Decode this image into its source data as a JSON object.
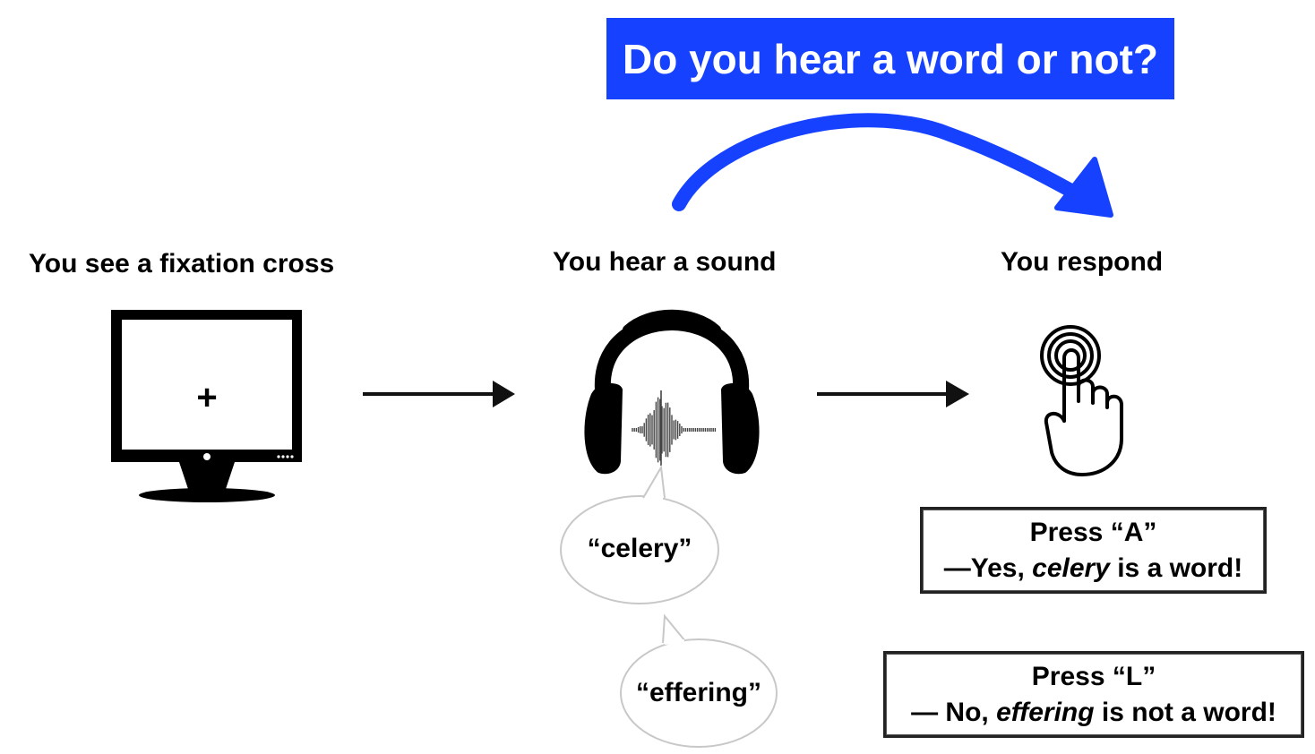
{
  "banner": {
    "text": "Do you hear a word or not?",
    "color": "#1642ff"
  },
  "steps": [
    {
      "label": "You see a fixation cross",
      "icon": "monitor-icon"
    },
    {
      "label": "You hear a sound",
      "icon": "headphones-icon"
    },
    {
      "label": "You respond",
      "icon": "touch-icon"
    }
  ],
  "fixation": "+",
  "bubbles": [
    {
      "text": "“celery”"
    },
    {
      "text": "“effering”"
    }
  ],
  "responses": [
    {
      "line1": "Press “A”",
      "prefix": "—Yes, ",
      "word": "celery",
      "suffix": " is a word!"
    },
    {
      "line1": "Press “L”",
      "prefix": "— No, ",
      "word": "effering",
      "suffix": " is not a word!"
    }
  ]
}
